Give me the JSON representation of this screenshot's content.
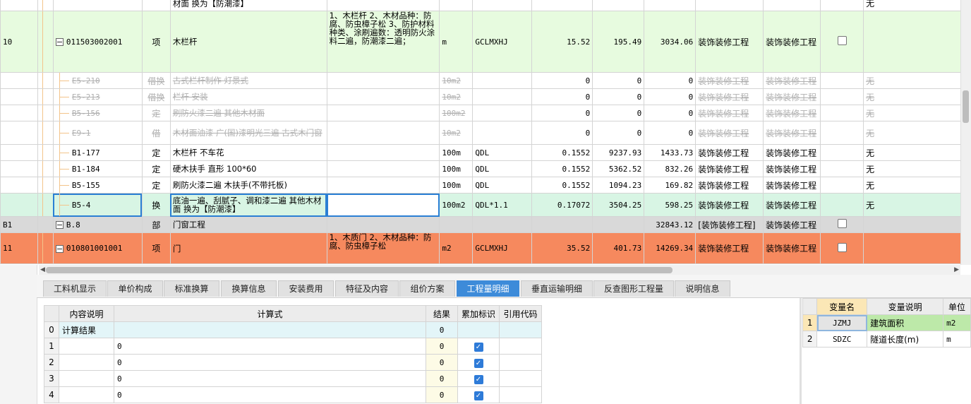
{
  "main_rows": [
    {
      "no": "",
      "code": "",
      "type": "",
      "name": "材面 换为【防潮漆】",
      "feature": "",
      "unit": "",
      "expr": "",
      "qty": "",
      "price": "",
      "total": "",
      "cat1": "",
      "cat2": "",
      "extra": "无"
    },
    {
      "no": "10",
      "code": "011503002001",
      "type": "项",
      "name": "木栏杆",
      "feature": "1、木栏杆\n2、木材品种：防腐、防虫樟子松\n3、防护材料种类、涂刷遍数：透明防火涂料二遍，防潮漆二遍；",
      "unit": "m",
      "expr": "GCLMXHJ",
      "qty": "15.52",
      "price": "195.49",
      "total": "3034.06",
      "cat1": "装饰装修工程",
      "cat2": "装饰装修工程",
      "extra": ""
    },
    {
      "no": "",
      "code": "E5-210",
      "type": "借换",
      "name": "古式栏杆制作 灯景式",
      "feature": "",
      "unit": "10m2",
      "expr": "",
      "qty": "0",
      "price": "0",
      "total": "0",
      "cat1": "装饰装修工程",
      "cat2": "装饰装修工程",
      "extra": "无"
    },
    {
      "no": "",
      "code": "E5-213",
      "type": "借换",
      "name": "栏杆 安装",
      "feature": "",
      "unit": "10m2",
      "expr": "",
      "qty": "0",
      "price": "0",
      "total": "0",
      "cat1": "装饰装修工程",
      "cat2": "装饰装修工程",
      "extra": "无"
    },
    {
      "no": "",
      "code": "B5-156",
      "type": "定",
      "name": "刷防火漆二遍 其他木材面",
      "feature": "",
      "unit": "100m2",
      "expr": "",
      "qty": "0",
      "price": "0",
      "total": "0",
      "cat1": "装饰装修工程",
      "cat2": "装饰装修工程",
      "extra": "无"
    },
    {
      "no": "",
      "code": "E9-1",
      "type": "借",
      "name": "木材面油漆 广(国)漆明光三遍 古式木门窗",
      "feature": "",
      "unit": "10m2",
      "expr": "",
      "qty": "0",
      "price": "0",
      "total": "0",
      "cat1": "装饰装修工程",
      "cat2": "装饰装修工程",
      "extra": "无"
    },
    {
      "no": "",
      "code": "B1-177",
      "type": "定",
      "name": "木栏杆 不车花",
      "feature": "",
      "unit": "100m",
      "expr": "QDL",
      "qty": "0.1552",
      "price": "9237.93",
      "total": "1433.73",
      "cat1": "装饰装修工程",
      "cat2": "装饰装修工程",
      "extra": "无"
    },
    {
      "no": "",
      "code": "B1-184",
      "type": "定",
      "name": "硬木扶手 直形 100*60",
      "feature": "",
      "unit": "100m",
      "expr": "QDL",
      "qty": "0.1552",
      "price": "5362.52",
      "total": "832.26",
      "cat1": "装饰装修工程",
      "cat2": "装饰装修工程",
      "extra": "无"
    },
    {
      "no": "",
      "code": "B5-155",
      "type": "定",
      "name": "刷防火漆二遍 木扶手(不带托板)",
      "feature": "",
      "unit": "100m",
      "expr": "QDL",
      "qty": "0.1552",
      "price": "1094.23",
      "total": "169.82",
      "cat1": "装饰装修工程",
      "cat2": "装饰装修工程",
      "extra": "无"
    },
    {
      "no": "",
      "code": "B5-4",
      "type": "换",
      "name": "底油一遍、刮腻子、调和漆二遍 其他木材面 换为【防潮漆】",
      "feature": "",
      "unit": "100m2",
      "expr": "QDL*1.1",
      "qty": "0.17072",
      "price": "3504.25",
      "total": "598.25",
      "cat1": "装饰装修工程",
      "cat2": "装饰装修工程",
      "extra": "无"
    },
    {
      "no": "B1",
      "code": "B.8",
      "type": "部",
      "name": "门窗工程",
      "feature": "",
      "unit": "",
      "expr": "",
      "qty": "",
      "price": "",
      "total": "32843.12",
      "cat1": "[装饰装修工程]",
      "cat2": "装饰装修工程",
      "extra": ""
    },
    {
      "no": "11",
      "code": "010801001001",
      "type": "项",
      "name": "门",
      "feature": "1、木质门\n2、木材品种：防腐、防虫樟子松",
      "unit": "m2",
      "expr": "GCLMXHJ",
      "qty": "35.52",
      "price": "401.73",
      "total": "14269.34",
      "cat1": "装饰装修工程",
      "cat2": "装饰装修工程",
      "extra": ""
    }
  ],
  "tabs": [
    "工料机显示",
    "单价构成",
    "标准换算",
    "换算信息",
    "安装费用",
    "特征及内容",
    "组价方案",
    "工程量明细",
    "垂直运输明细",
    "反查图形工程量",
    "说明信息"
  ],
  "active_tab": "工程量明细",
  "calc_table": {
    "headers": [
      "内容说明",
      "计算式",
      "结果",
      "累加标识",
      "引用代码"
    ],
    "rows": [
      {
        "num": "0",
        "desc": "计算结果",
        "formula": "",
        "result": "0",
        "checked": false
      },
      {
        "num": "1",
        "desc": "",
        "formula": "0",
        "result": "0",
        "checked": true
      },
      {
        "num": "2",
        "desc": "",
        "formula": "0",
        "result": "0",
        "checked": true
      },
      {
        "num": "3",
        "desc": "",
        "formula": "0",
        "result": "0",
        "checked": true
      },
      {
        "num": "4",
        "desc": "",
        "formula": "0",
        "result": "0",
        "checked": true
      }
    ]
  },
  "var_table": {
    "headers": [
      "变量名",
      "变量说明",
      "单位"
    ],
    "rows": [
      {
        "num": "1",
        "name": "JZMJ",
        "desc": "建筑面积",
        "unit": "m2"
      },
      {
        "num": "2",
        "name": "SDZC",
        "desc": "隧道长度(m)",
        "unit": "m"
      }
    ]
  },
  "colors": {
    "accent": "#3d8bd9",
    "item_row": "#e7fbdf",
    "orange_row": "#f6895e",
    "section_row": "#d9d9d9"
  }
}
